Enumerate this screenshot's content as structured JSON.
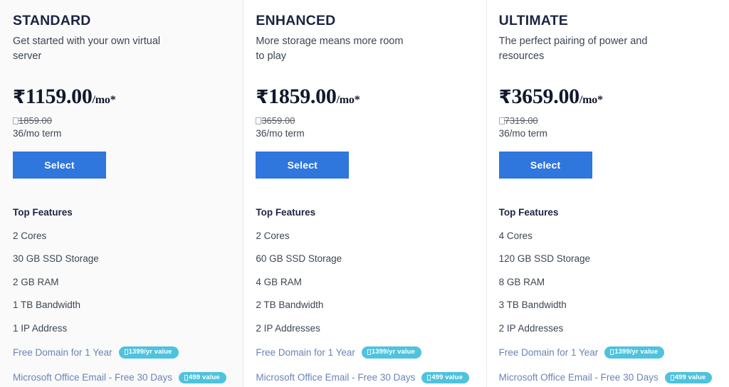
{
  "currency_symbol": "₹",
  "colors": {
    "accent_button": "#2f76dd",
    "badge": "#4ec3dd",
    "promo_text": "#6b84b5",
    "heading": "#1c2440",
    "body_text": "#3d4553",
    "divider": "#e4e6e8",
    "shaded_column_bg": "#fafafa"
  },
  "plans": [
    {
      "name": "STANDARD",
      "tagline": "Get started with your own virtual server",
      "price": "₹1159.00",
      "price_amount": "1159.00",
      "price_suffix": "/mo*",
      "old_price": "1859.00",
      "term": "36/mo term",
      "select_label": "Select",
      "features_title": "Top Features",
      "features": [
        {
          "label": "2 Cores",
          "promo": false,
          "badge": null
        },
        {
          "label": "30 GB SSD Storage",
          "promo": false,
          "badge": null
        },
        {
          "label": "2 GB RAM",
          "promo": false,
          "badge": null
        },
        {
          "label": "1 TB Bandwidth",
          "promo": false,
          "badge": null
        },
        {
          "label": "1 IP Address",
          "promo": false,
          "badge": null
        },
        {
          "label": "Free Domain for 1 Year",
          "promo": true,
          "badge": "1399/yr value"
        },
        {
          "label": "Microsoft Office Email - Free 30 Days",
          "promo": true,
          "badge": "499 value"
        }
      ]
    },
    {
      "name": "ENHANCED",
      "tagline": "More storage means more room to play",
      "price": "₹1859.00",
      "price_amount": "1859.00",
      "price_suffix": "/mo*",
      "old_price": "3659.00",
      "term": "36/mo term",
      "select_label": "Select",
      "features_title": "Top Features",
      "features": [
        {
          "label": "2 Cores",
          "promo": false,
          "badge": null
        },
        {
          "label": "60 GB SSD Storage",
          "promo": false,
          "badge": null
        },
        {
          "label": "4 GB RAM",
          "promo": false,
          "badge": null
        },
        {
          "label": "2 TB Bandwidth",
          "promo": false,
          "badge": null
        },
        {
          "label": "2 IP Addresses",
          "promo": false,
          "badge": null
        },
        {
          "label": "Free Domain for 1 Year",
          "promo": true,
          "badge": "1399/yr value"
        },
        {
          "label": "Microsoft Office Email - Free 30 Days",
          "promo": true,
          "badge": "499 value"
        }
      ]
    },
    {
      "name": "ULTIMATE",
      "tagline": "The perfect pairing of power and resources",
      "price": "₹3659.00",
      "price_amount": "3659.00",
      "price_suffix": "/mo*",
      "old_price": "7319.00",
      "term": "36/mo term",
      "select_label": "Select",
      "features_title": "Top Features",
      "features": [
        {
          "label": "4 Cores",
          "promo": false,
          "badge": null
        },
        {
          "label": "120 GB SSD Storage",
          "promo": false,
          "badge": null
        },
        {
          "label": "8 GB RAM",
          "promo": false,
          "badge": null
        },
        {
          "label": "3 TB Bandwidth",
          "promo": false,
          "badge": null
        },
        {
          "label": "2 IP Addresses",
          "promo": false,
          "badge": null
        },
        {
          "label": "Free Domain for 1 Year",
          "promo": true,
          "badge": "1399/yr value"
        },
        {
          "label": "Microsoft Office Email - Free 30 Days",
          "promo": true,
          "badge": "499 value"
        }
      ]
    }
  ]
}
